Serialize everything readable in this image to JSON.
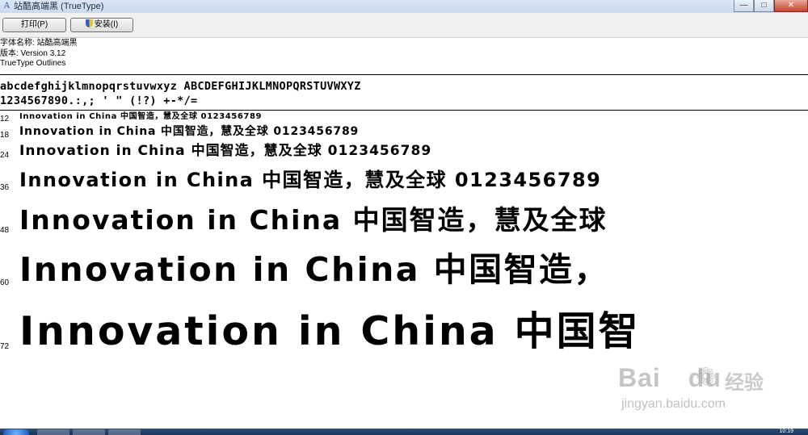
{
  "window": {
    "title": "站酷高端黑 (TrueType)",
    "icon": "font-file-icon",
    "controls": [
      "minimize",
      "maximize",
      "close"
    ]
  },
  "toolbar": {
    "print_label": "打印(P)",
    "install_label": "安装(I)"
  },
  "font_info": {
    "name_line": "字体名称: 站酷高端黑",
    "version_line": "版本: Version 3.12",
    "outline_line": "TrueType Outlines"
  },
  "charset": {
    "line1": "abcdefghijklmnopqrstuvwxyz ABCDEFGHIJKLMNOPQRSTUVWXYZ",
    "line2": "1234567890.:,; ' \" (!?) +-*/="
  },
  "samples": [
    {
      "size": "12",
      "text": "Innovation in China 中国智造，慧及全球 0123456789"
    },
    {
      "size": "18",
      "text": "Innovation in China 中国智造，慧及全球 0123456789"
    },
    {
      "size": "24",
      "text": "Innovation in China 中国智造，慧及全球 0123456789"
    },
    {
      "size": "36",
      "text": "Innovation in China 中国智造，慧及全球 0123456789"
    },
    {
      "size": "48",
      "text": "Innovation in China 中国智造，慧及全球"
    },
    {
      "size": "60",
      "text": "Innovation in China 中国智造，"
    },
    {
      "size": "72",
      "text": "Innovation in China 中国智"
    }
  ],
  "watermark": {
    "brand": "Bai",
    "brand2": "du",
    "sub": "经验",
    "url": "jingyan.baidu.com"
  },
  "taskbar": {
    "clock": "10:19"
  }
}
